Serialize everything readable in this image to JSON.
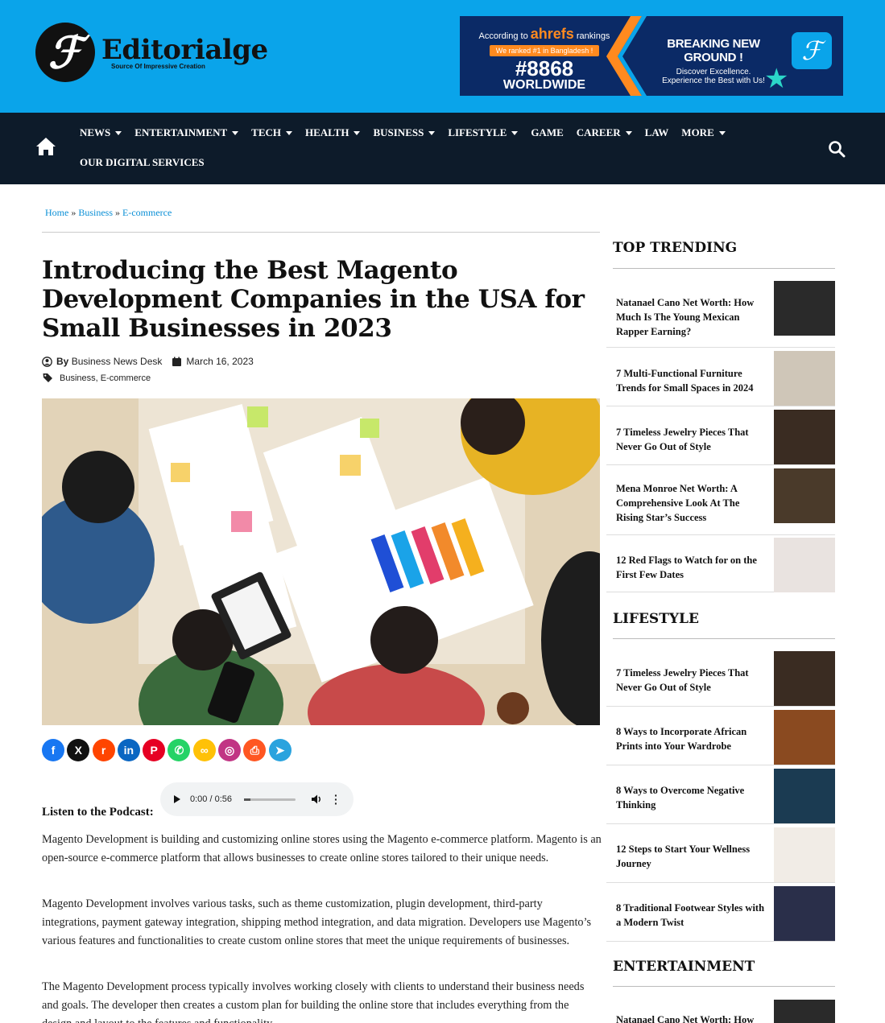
{
  "brand": {
    "name": "Editorialge",
    "tagline": "Source Of Impressive Creation",
    "mark": "ℱ"
  },
  "ad": {
    "according": "According to",
    "ahrefs": "ahrefs",
    "rankings": "rankings",
    "ranked": "We ranked #1 in Bangladesh !",
    "rank": "#8868",
    "worldwide": "WORLDWIDE",
    "headline": "BREAKING NEW GROUND !",
    "sub1": "Discover Excellence.",
    "sub2": "Experience the Best with Us!"
  },
  "nav": {
    "row1": [
      {
        "label": "NEWS",
        "caret": true
      },
      {
        "label": "ENTERTAINMENT",
        "caret": true
      },
      {
        "label": "TECH",
        "caret": true
      },
      {
        "label": "HEALTH",
        "caret": true
      },
      {
        "label": "BUSINESS",
        "caret": true
      },
      {
        "label": "LIFESTYLE",
        "caret": true
      },
      {
        "label": "GAME",
        "caret": false
      },
      {
        "label": "CAREER",
        "caret": true
      },
      {
        "label": "LAW",
        "caret": false
      },
      {
        "label": "MORE",
        "caret": true
      }
    ],
    "row2": [
      {
        "label": "OUR DIGITAL SERVICES",
        "caret": false
      }
    ]
  },
  "breadcrumb": {
    "home": "Home",
    "sep": "»",
    "business": "Business",
    "ecommerce": "E-commerce"
  },
  "article": {
    "title": "Introducing the Best Magento Development Companies in the USA for Small Businesses in 2023",
    "by": "By",
    "author": "Business News Desk",
    "date": "March 16, 2023",
    "categories": "Business, E-commerce",
    "podcast_label": "Listen to the Podcast:",
    "audio_time": "0:00 / 0:56",
    "paragraphs": [
      "Magento Development is building and customizing online stores using the Magento e-commerce platform. Magento is an open-source e-commerce platform that allows businesses to create online stores tailored to their unique needs.",
      "Magento Development involves various tasks, such as theme customization, plugin development, third-party integrations, payment gateway integration, shipping method integration, and data migration. Developers use Magento’s various features and functionalities to create custom online stores that meet the unique requirements of businesses.",
      "The Magento Development process typically involves working closely with clients to understand their business needs and goals. The developer then creates a custom plan for building the online store that includes everything from the design and layout to the features and functionality."
    ]
  },
  "share_icons": [
    {
      "name": "facebook-icon",
      "glyph": "f",
      "color": "#1877f2"
    },
    {
      "name": "x-icon",
      "glyph": "X",
      "color": "#111111"
    },
    {
      "name": "reddit-icon",
      "glyph": "r",
      "color": "#ff4500"
    },
    {
      "name": "linkedin-icon",
      "glyph": "in",
      "color": "#0a66c2"
    },
    {
      "name": "pinterest-icon",
      "glyph": "P",
      "color": "#e60023"
    },
    {
      "name": "whatsapp-icon",
      "glyph": "✆",
      "color": "#25d366"
    },
    {
      "name": "copy-link-icon",
      "glyph": "∞",
      "color": "#ffc107"
    },
    {
      "name": "instagram-icon",
      "glyph": "◎",
      "color": "#c13584"
    },
    {
      "name": "print-icon",
      "glyph": "⎙",
      "color": "#ff5722"
    },
    {
      "name": "telegram-icon",
      "glyph": "➤",
      "color": "#2aa3de"
    }
  ],
  "sidebar": {
    "sections": [
      {
        "title": "TOP TRENDING",
        "items": [
          {
            "title": "Natanael Cano Net Worth: How Much Is The Young Mexican Rapper Earning?",
            "thumb": "#2a2a2a"
          },
          {
            "title": "7 Multi-Functional Furniture Trends for Small Spaces in 2024",
            "thumb": "#cfc6b8"
          },
          {
            "title": "7 Timeless Jewelry Pieces That Never Go Out of Style",
            "thumb": "#3a2c22"
          },
          {
            "title": "Mena Monroe Net Worth: A Comprehensive Look At The Rising Star’s Success",
            "thumb": "#4a3a2a"
          },
          {
            "title": "12 Red Flags to Watch for on the First Few Dates",
            "thumb": "#e9e3e0"
          }
        ]
      },
      {
        "title": "LIFESTYLE",
        "items": [
          {
            "title": "7 Timeless Jewelry Pieces That Never Go Out of Style",
            "thumb": "#3a2c22"
          },
          {
            "title": "8 Ways to Incorporate African Prints into Your Wardrobe",
            "thumb": "#8a4a20"
          },
          {
            "title": "8 Ways to Overcome Negative Thinking",
            "thumb": "#1b3b52"
          },
          {
            "title": "12 Steps to Start Your Wellness Journey",
            "thumb": "#f1ece6"
          },
          {
            "title": "8 Traditional Footwear Styles with a Modern Twist",
            "thumb": "#2a2f4a"
          }
        ]
      },
      {
        "title": "ENTERTAINMENT",
        "items": [
          {
            "title": "Natanael Cano Net Worth: How Much Is The Young Mexican Rapper Earning?",
            "thumb": "#2a2a2a"
          }
        ]
      }
    ]
  }
}
